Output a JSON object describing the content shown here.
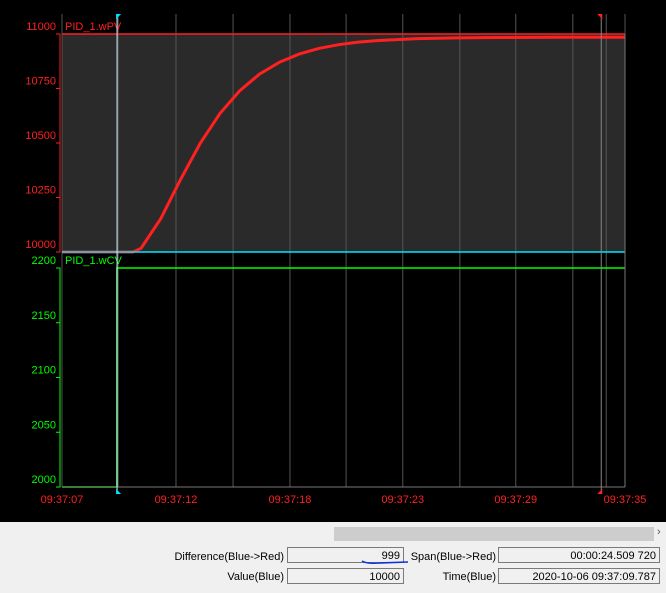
{
  "chart_data": [
    {
      "type": "line",
      "title": "PID_1.wPV",
      "ylim": [
        10000,
        11000
      ],
      "yticks": [
        "11000",
        "10750",
        "10500",
        "10250",
        "10000"
      ],
      "color": "#ff2020",
      "x_seconds_from_start": [
        0,
        1,
        2,
        3,
        3.6,
        4,
        5,
        6,
        7,
        8,
        9,
        10,
        11,
        12,
        13,
        14,
        15,
        16,
        18,
        20,
        22,
        25,
        28.5
      ],
      "values": [
        10000,
        10000,
        10000,
        10000,
        10000,
        10017,
        10153,
        10332,
        10499,
        10636,
        10740,
        10816,
        10870,
        10908,
        10934,
        10951,
        10963,
        10970,
        10979,
        10982,
        10984,
        10985,
        10985
      ]
    },
    {
      "type": "line",
      "title": "PID_1.wCV",
      "ylim": [
        2000,
        2200
      ],
      "yticks": [
        "2200",
        "2150",
        "2100",
        "2050",
        "2000"
      ],
      "color": "#00ff00",
      "x_seconds_from_start": [
        0,
        2.78,
        2.78,
        28.5
      ],
      "values": [
        2000,
        2000,
        2200,
        2200
      ]
    }
  ],
  "time_axis": {
    "range_seconds": 28.5,
    "ticks": [
      {
        "label": "09:37:07",
        "t": 0
      },
      {
        "label": "09:37:12",
        "t": 5.77
      },
      {
        "label": "09:37:18",
        "t": 11.54
      },
      {
        "label": "09:37:23",
        "t": 17.25
      },
      {
        "label": "09:37:29",
        "t": 22.97
      },
      {
        "label": "09:37:35",
        "t": 28.5
      }
    ],
    "grid_t": [
      0,
      2.84,
      5.77,
      8.66,
      11.54,
      14.38,
      17.25,
      20.14,
      22.97,
      25.86,
      27.55,
      28.5
    ]
  },
  "cursors": {
    "blue_t": 2.787,
    "red_t": 27.297,
    "blue_color": "#00e5ff",
    "red_color": "#ff2020"
  },
  "readouts": {
    "difference_label": "Difference(Blue->Red)",
    "difference_value": "999",
    "span_label": "Span(Blue->Red)",
    "span_value": "00:00:24.509 720",
    "value_label": "Value(Blue)",
    "value_value": "10000",
    "time_label": "Time(Blue)",
    "time_value": "2020-10-06 09:37:09.787"
  },
  "scroll_arrow": "›"
}
